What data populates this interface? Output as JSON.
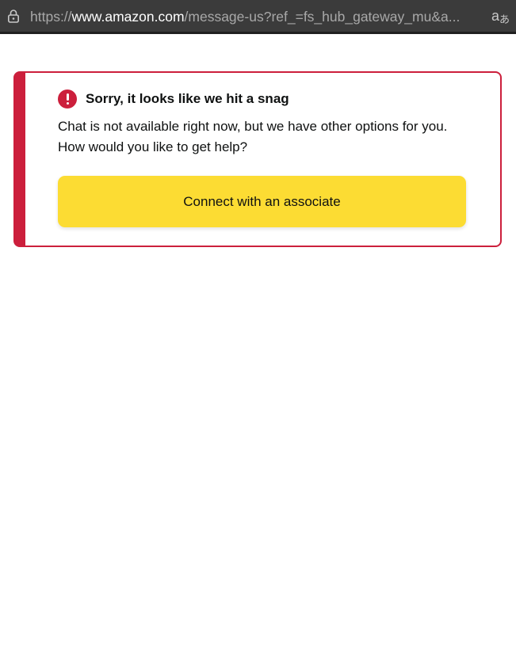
{
  "browser": {
    "url_prefix": "https://",
    "url_host": "www.amazon.com",
    "url_path": "/message-us?ref_=fs_hub_gateway_mu&a...",
    "translate_glyph_latin": "a",
    "translate_glyph_kana": "あ",
    "icons": {
      "lock": "lock-icon",
      "translate": "translate-icon"
    }
  },
  "alert": {
    "title": "Sorry, it looks like we hit a snag",
    "message": "Chat is not available right now, but we have other options for you. How would you like to get help?",
    "button_label": "Connect with an associate",
    "icon": "exclamation-circle-icon"
  },
  "colors": {
    "alert_red": "#cc1f3c",
    "button_yellow": "#fcdc33",
    "text": "#0f1111",
    "address_bar_bg": "#3b3b3b"
  }
}
